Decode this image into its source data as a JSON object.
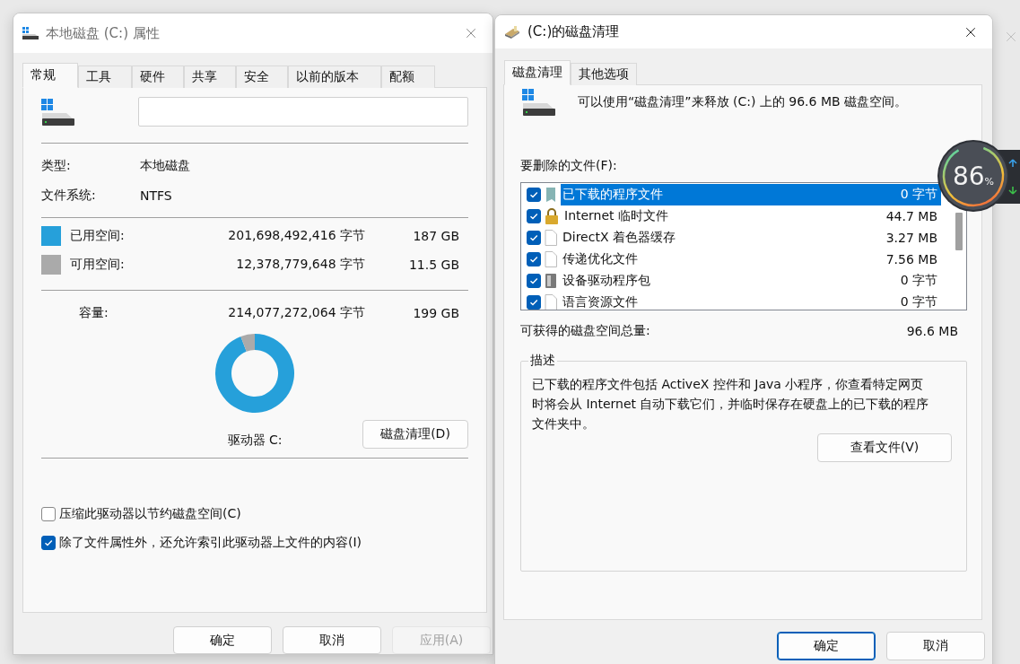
{
  "left_dialog": {
    "title": "本地磁盘 (C:) 属性",
    "active": false,
    "tabs": [
      {
        "label": "常规",
        "selected": true
      },
      {
        "label": "工具",
        "selected": false
      },
      {
        "label": "硬件",
        "selected": false
      },
      {
        "label": "共享",
        "selected": false
      },
      {
        "label": "安全",
        "selected": false
      },
      {
        "label": "以前的版本",
        "selected": false
      },
      {
        "label": "配额",
        "selected": false
      }
    ],
    "info": [
      {
        "label": "类型:",
        "value": "本地磁盘"
      },
      {
        "label": "文件系统:",
        "value": "NTFS"
      }
    ],
    "space": [
      {
        "label": "已用空间:",
        "bytes": "201,698,492,416 字节",
        "size": "187 GB",
        "color": "#26a0da"
      },
      {
        "label": "可用空间:",
        "bytes": "12,378,779,648 字节",
        "size": "11.5 GB",
        "color": "#aaaaaa"
      }
    ],
    "capacity": {
      "label": "容量:",
      "bytes": "214,077,272,064 字节",
      "size": "199 GB"
    },
    "usage": {
      "chart_data": {
        "type": "donut",
        "values": [
          94.2,
          5.8
        ]
      }
    },
    "drive_label": "驱动器 C:",
    "cleanup_button": "磁盘清理(D)",
    "options": [
      {
        "label": "压缩此驱动器以节约磁盘空间(C)",
        "checked": false
      },
      {
        "label": "除了文件属性外，还允许索引此驱动器上文件的内容(I)",
        "checked": true
      }
    ],
    "buttons": [
      {
        "label": "确定",
        "disabled": false
      },
      {
        "label": "取消",
        "disabled": false
      },
      {
        "label": "应用(A)",
        "disabled": true
      }
    ]
  },
  "right_dialog": {
    "title": "(C:)的磁盘清理",
    "active": true,
    "tabs": [
      {
        "label": "磁盘清理",
        "selected": true
      },
      {
        "label": "其他选项",
        "selected": false
      }
    ],
    "message": "可以使用“磁盘清理”来释放  (C:) 上的 96.6 MB 磁盘空间。",
    "files_label": "要删除的文件(F):",
    "files": [
      {
        "name": "已下载的程序文件",
        "size": "0 字节",
        "checked": true,
        "selected": true,
        "kind": "package"
      },
      {
        "name": "Internet 临时文件",
        "size": "44.7 MB",
        "checked": true,
        "selected": false,
        "kind": "lock"
      },
      {
        "name": "DirectX 着色器缓存",
        "size": "3.27 MB",
        "checked": true,
        "selected": false,
        "kind": "file"
      },
      {
        "name": "传递优化文件",
        "size": "7.56 MB",
        "checked": true,
        "selected": false,
        "kind": "file"
      },
      {
        "name": "设备驱动程序包",
        "size": "0 字节",
        "checked": true,
        "selected": false,
        "kind": "driver"
      },
      {
        "name": "语言资源文件",
        "size": "0 字节",
        "checked": true,
        "selected": false,
        "kind": "file"
      }
    ],
    "total_label": "可获得的磁盘空间总量:",
    "total_value": "96.6 MB",
    "description_legend": "描述",
    "description": "已下载的程序文件包括 ActiveX 控件和 Java 小程序，你查看特定网页时将会从 Internet 自动下载它们，并临时保存在硬盘上的已下载的程序文件夹中。",
    "view_button": "查看文件(V)",
    "buttons": [
      {
        "label": "确定",
        "default": true
      },
      {
        "label": "取消",
        "default": false
      }
    ]
  },
  "widget": {
    "value": "86",
    "unit": "%"
  }
}
